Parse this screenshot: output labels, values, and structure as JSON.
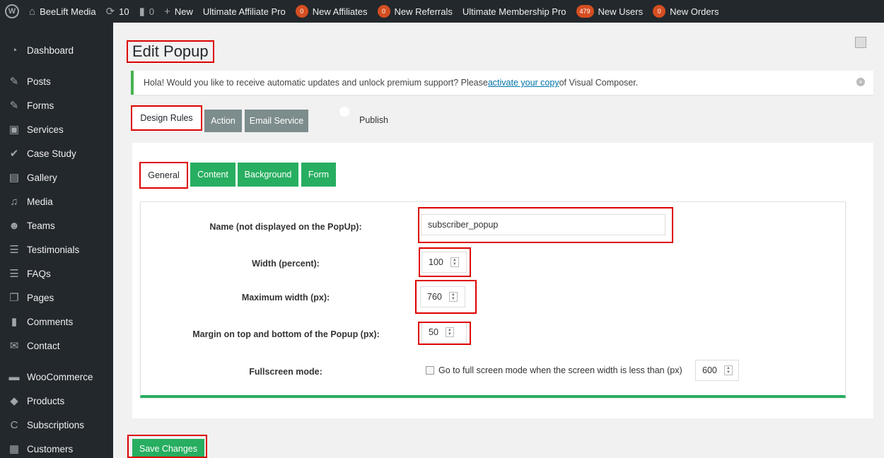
{
  "adminbar": {
    "site_name": "BeeLift Media",
    "updates_count": "10",
    "comments_count": "0",
    "new_label": "New",
    "items": [
      {
        "label": "Ultimate Affiliate Pro"
      },
      {
        "badge": "0",
        "label": "New Affiliates"
      },
      {
        "badge": "0",
        "label": "New Referrals"
      },
      {
        "label": "Ultimate Membership Pro"
      },
      {
        "badge": "479",
        "label": "New Users"
      },
      {
        "badge": "0",
        "label": "New Orders"
      }
    ]
  },
  "sidebar": {
    "items": [
      {
        "label": "Dashboard",
        "icon": "dashboard-icon"
      },
      {
        "label": "Posts",
        "icon": "pin-icon"
      },
      {
        "label": "Forms",
        "icon": "pin-icon"
      },
      {
        "label": "Services",
        "icon": "briefcase-icon"
      },
      {
        "label": "Case Study",
        "icon": "wrench-icon"
      },
      {
        "label": "Gallery",
        "icon": "gallery-icon"
      },
      {
        "label": "Media",
        "icon": "media-icon"
      },
      {
        "label": "Teams",
        "icon": "groups-icon"
      },
      {
        "label": "Testimonials",
        "icon": "testimonial-icon"
      },
      {
        "label": "FAQs",
        "icon": "testimonial-icon"
      },
      {
        "label": "Pages",
        "icon": "pages-icon"
      },
      {
        "label": "Comments",
        "icon": "comment-icon"
      },
      {
        "label": "Contact",
        "icon": "envelope-icon"
      },
      {
        "label": "WooCommerce",
        "icon": "woo-icon"
      },
      {
        "label": "Products",
        "icon": "box-icon"
      },
      {
        "label": "Subscriptions",
        "icon": "refresh-icon"
      },
      {
        "label": "Customers",
        "icon": "id-card-icon"
      }
    ]
  },
  "page": {
    "title": "Edit Popup"
  },
  "notice": {
    "text_before": "Hola! Would you like to receive automatic updates and unlock premium support? Please ",
    "link_text": "activate your copy",
    "text_after": " of Visual Composer."
  },
  "top_tabs": {
    "design_rules": "Design Rules",
    "action": "Action",
    "email_service": "Email Service",
    "publish": "Publish"
  },
  "sub_tabs": {
    "general": "General",
    "content": "Content",
    "background": "Background",
    "form": "Form"
  },
  "form": {
    "name_label": "Name (not displayed on the PopUp):",
    "name_value": "subscriber_popup",
    "width_label": "Width (percent):",
    "width_value": "100",
    "max_width_label": "Maximum width (px):",
    "max_width_value": "760",
    "margin_label": "Margin on top and bottom of the Popup (px):",
    "margin_value": "50",
    "fullscreen_label": "Fullscreen mode:",
    "fullscreen_text": "Go to full screen mode when the screen width is less than (px)",
    "fullscreen_value": "600"
  },
  "save_button": "Save Changes"
}
